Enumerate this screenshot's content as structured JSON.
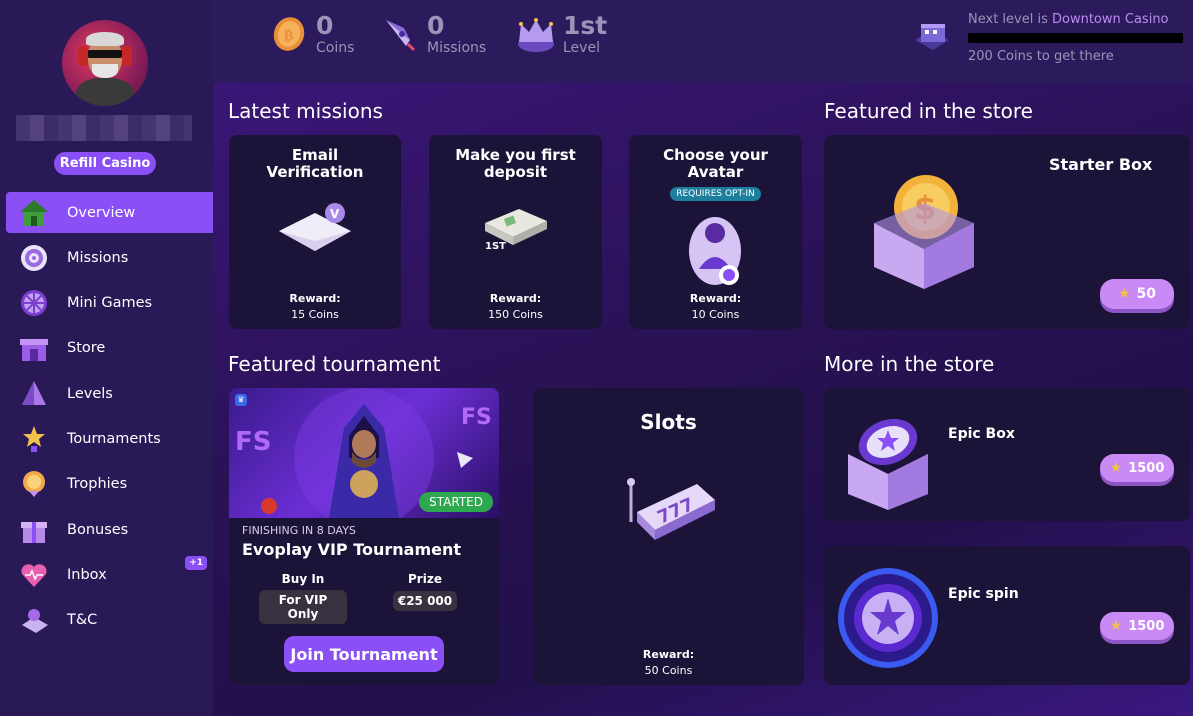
{
  "sidebar": {
    "refill_label": "Refill Casino",
    "items": [
      {
        "label": "Overview",
        "icon": "house-icon"
      },
      {
        "label": "Missions",
        "icon": "target-icon"
      },
      {
        "label": "Mini Games",
        "icon": "wheel-icon"
      },
      {
        "label": "Store",
        "icon": "store-icon"
      },
      {
        "label": "Levels",
        "icon": "levels-icon"
      },
      {
        "label": "Tournaments",
        "icon": "trophy-star-icon"
      },
      {
        "label": "Trophies",
        "icon": "medal-icon"
      },
      {
        "label": "Bonuses",
        "icon": "gift-icon"
      },
      {
        "label": "Inbox",
        "icon": "heart-icon",
        "badge": "+1"
      },
      {
        "label": "T&C",
        "icon": "document-icon"
      }
    ]
  },
  "header": {
    "coins": {
      "value": "0",
      "label": "Coins"
    },
    "missions": {
      "value": "0",
      "label": "Missions"
    },
    "level": {
      "value": "1st",
      "label": "Level"
    },
    "next_level": {
      "prefix": "Next level is",
      "name": "Downtown Casino",
      "coins_needed": "200",
      "suffix": "Coins to get there",
      "progress": 0
    }
  },
  "sections": {
    "latest_missions": "Latest missions",
    "featured_store": "Featured in the store",
    "featured_tournament": "Featured tournament",
    "more_store": "More in the store"
  },
  "missions": [
    {
      "title": "Email Verification",
      "reward_label": "Reward:",
      "reward": "15 Coins"
    },
    {
      "title": "Make you first deposit",
      "image_text": "1ST",
      "reward_label": "Reward:",
      "reward": "150 Coins"
    },
    {
      "title": "Choose your Avatar",
      "tag": "REQUIRES OPT-IN",
      "reward_label": "Reward:",
      "reward": "10 Coins"
    }
  ],
  "store": {
    "featured": {
      "name": "Starter Box",
      "price": "50"
    },
    "more": [
      {
        "name": "Epic Box",
        "price": "1500"
      },
      {
        "name": "Epic spin",
        "price": "1500"
      }
    ]
  },
  "tournament": {
    "status": "STARTED",
    "subtitle": "FINISHING IN 8 DAYS",
    "name": "Evoplay VIP Tournament",
    "buyin_label": "Buy In",
    "buyin": "For VIP Only",
    "prize_label": "Prize",
    "prize": "€25 000",
    "join_label": "Join Tournament"
  },
  "slots": {
    "title": "Slots",
    "reward_label": "Reward:",
    "reward": "50 Coins"
  },
  "colors": {
    "accent": "#8a4ff5",
    "panel": "#1c1338",
    "sidebar": "#2a1957",
    "started": "#2ea84f"
  }
}
